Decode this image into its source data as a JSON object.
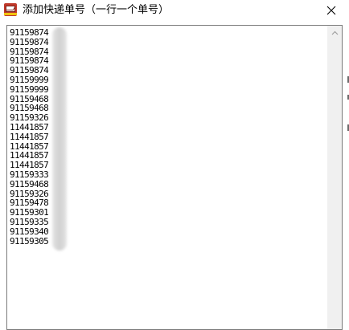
{
  "window": {
    "title": "添加快递单号（一行一个单号）",
    "close_icon": "close-icon",
    "app_icon": "app-logo-icon"
  },
  "textarea": {
    "lines": [
      "91159874",
      "91159874",
      "91159874",
      "91159874",
      "91159874",
      "91159999",
      "91159999",
      "91159468",
      "91159468",
      "91159326",
      "11441857",
      "11441857",
      "11441857",
      "11441857",
      "11441857",
      "91159333",
      "91159468",
      "91159326",
      "91159478",
      "91159301",
      "91159335",
      "91159340",
      "91159305"
    ]
  },
  "colors": {
    "border": "#7a7a7a",
    "scrollbar_track": "#f0f0f0",
    "redaction": "#d6d6d6"
  }
}
